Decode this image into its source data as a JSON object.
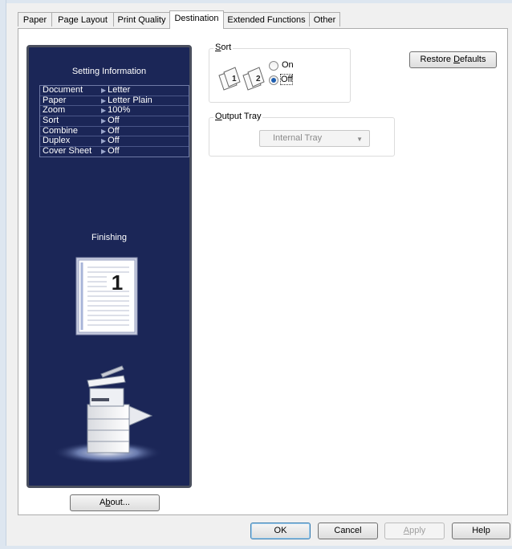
{
  "tabs": [
    "Paper",
    "Page Layout",
    "Print Quality",
    "Destination",
    "Extended Functions",
    "Other"
  ],
  "info": {
    "title": "Setting Information",
    "rows": [
      {
        "key": "Document",
        "value": "Letter"
      },
      {
        "key": "Paper",
        "value": "Letter Plain"
      },
      {
        "key": "Zoom",
        "value": "100%"
      },
      {
        "key": "Sort",
        "value": "Off"
      },
      {
        "key": "Combine",
        "value": "Off"
      },
      {
        "key": "Duplex",
        "value": "Off"
      },
      {
        "key": "Cover Sheet",
        "value": "Off"
      }
    ],
    "finishing_title": "Finishing",
    "page_number": "1"
  },
  "about_button": {
    "pre": "A",
    "accel": "b",
    "post": "out..."
  },
  "sort": {
    "label_accel": "S",
    "label_rest": "ort",
    "on_label": "On",
    "off_label": "Off",
    "selected": "off",
    "icon_pages": [
      "1",
      "2"
    ]
  },
  "output_tray": {
    "label_accel": "O",
    "label_rest": "utput Tray",
    "value": "Internal Tray"
  },
  "restore_defaults": {
    "pre": "Restore ",
    "accel": "D",
    "post": "efaults"
  },
  "footer": {
    "ok": "OK",
    "cancel": "Cancel",
    "apply_accel": "A",
    "apply_rest": "pply",
    "help": "Help"
  },
  "colors": {
    "info_panel_bg": "#1b2657",
    "radio_selected": "#1e5eb0"
  }
}
